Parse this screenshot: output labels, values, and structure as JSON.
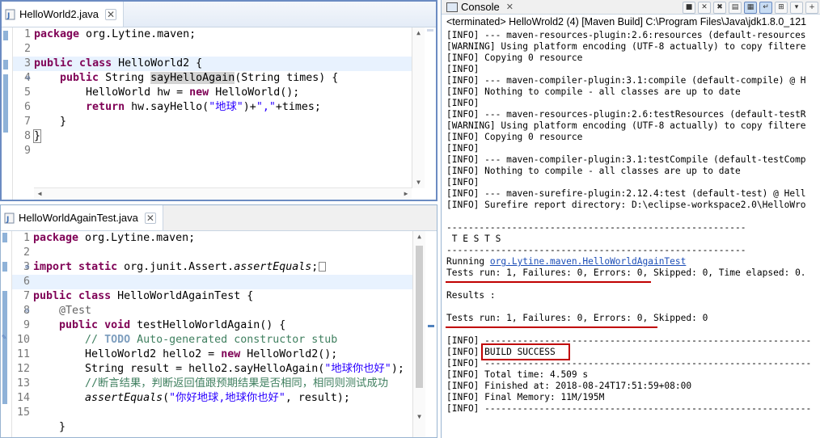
{
  "editor1": {
    "tab_label": "HelloWorld2.java",
    "line_numbers": [
      "1",
      "2",
      "3",
      "4",
      "5",
      "6",
      "7",
      "8",
      "9"
    ],
    "code": {
      "l1_kw": "package",
      "l1_rest": " org.Lytine.maven;",
      "l3_kw1": "public",
      "l3_kw2": " class",
      "l3_rest": " HelloWorld2 {",
      "l4_kw": "public",
      "l4_type": " String ",
      "l4_method": "sayHelloAgain",
      "l4_rest": "(String ",
      "l4_param": "times",
      "l4_end": ") {",
      "l5_type": "HelloWorld ",
      "l5_var": "hw",
      "l5_eq": " = ",
      "l5_kw": "new",
      "l5_rest": " HelloWorld();",
      "l6_kw": "return",
      "l6_sp": " ",
      "l6_var": "hw",
      "l6_call": ".sayHello(",
      "l6_str1": "\"地球\"",
      "l6_plus": ")+",
      "l6_str2": "\",\"",
      "l6_plus2": "+",
      "l6_param": "times",
      "l6_end": ";",
      "l7": "}",
      "l8": "}"
    }
  },
  "editor2": {
    "tab_label": "HelloWorldAgainTest.java",
    "line_numbers": [
      "1",
      "2",
      "3",
      "6",
      "7",
      "8",
      "9",
      "10",
      "11",
      "12",
      "13",
      "14",
      "15"
    ],
    "code": {
      "l1_kw": "package",
      "l1_rest": " org.Lytine.maven;",
      "l3_kw1": "import",
      "l3_kw2": " static",
      "l3_rest": " org.junit.Assert.",
      "l3_it": "assertEquals",
      "l3_end": ";",
      "l7_kw1": "public",
      "l7_kw2": " class",
      "l7_rest": " HelloWorldAgainTest {",
      "l8_ann": "@Test",
      "l9_kw1": "public",
      "l9_kw2": " void",
      "l9_rest": " testHelloWorldAgain() {",
      "l10_c1": "// ",
      "l10_tag": "TODO",
      "l10_c2": " Auto-generated constructor stub",
      "l11_type": "HelloWorld2 ",
      "l11_var": "hello2",
      "l11_eq": " = ",
      "l11_kw": "new",
      "l11_rest": " HelloWorld2();",
      "l12_type": "String ",
      "l12_var": "result",
      "l12_eq": " = ",
      "l12_var2": "hello2",
      "l12_call": ".sayHelloAgain(",
      "l12_str": "\"地球你也好\"",
      "l12_end": ");",
      "l13": "//断言结果，判断返回值跟预期结果是否相同，相同则测试成功",
      "l14_it": "assertEquals",
      "l14_open": "(",
      "l14_str": "\"你好地球,地球你也好\"",
      "l14_mid": ", ",
      "l14_var": "result",
      "l14_end": ");",
      "l16": "}"
    }
  },
  "console": {
    "tab_label": "Console",
    "terminated": "<terminated> HelloWrold2 (4) [Maven Build] C:\\Program Files\\Java\\jdk1.8.0_121",
    "lines": [
      "[INFO] --- maven-resources-plugin:2.6:resources (default-resources",
      "[WARNING] Using platform encoding (UTF-8 actually) to copy filtere",
      "[INFO] Copying 0 resource",
      "[INFO]",
      "[INFO] --- maven-compiler-plugin:3.1:compile (default-compile) @ H",
      "[INFO] Nothing to compile - all classes are up to date",
      "[INFO]",
      "[INFO] --- maven-resources-plugin:2.6:testResources (default-testR",
      "[WARNING] Using platform encoding (UTF-8 actually) to copy filtere",
      "[INFO] Copying 0 resource",
      "[INFO]",
      "[INFO] --- maven-compiler-plugin:3.1:testCompile (default-testComp",
      "[INFO] Nothing to compile - all classes are up to date",
      "[INFO]",
      "[INFO] --- maven-surefire-plugin:2.12.4:test (default-test) @ Hell",
      "[INFO] Surefire report directory: D:\\eclipse-workspace2.0\\HelloWro",
      "",
      "-------------------------------------------------------",
      " T E S T S",
      "-------------------------------------------------------"
    ],
    "running_prefix": "Running ",
    "running_link": "org.Lytine.maven.HelloWorldAgainTest",
    "tests_run_1": "Tests run: 1, Failures: 0, Errors: 0, Skipped: 0, Time elapsed: 0.",
    "blank1": "",
    "results": "Results :",
    "blank2": "",
    "tests_run_2": "Tests run: 1, Failures: 0, Errors: 0, Skipped: 0",
    "blank3": "",
    "sep1": "[INFO] ------------------------------------------------------------",
    "build_prefix": "[INFO] ",
    "build_success": "BUILD SUCCESS",
    "sep2": "[INFO] ------------------------------------------------------------",
    "total_time": "[INFO] Total time: 4.509 s",
    "finished_at": "[INFO] Finished at: 2018-08-24T17:51:59+08:00",
    "final_memory": "[INFO] Final Memory: 11M/195M",
    "sep3": "[INFO] ------------------------------------------------------------"
  },
  "colors": {
    "keyword": "#7f0055",
    "string": "#2a00ff",
    "comment": "#3f7f5f",
    "annotation_highlight": "#c00000"
  }
}
